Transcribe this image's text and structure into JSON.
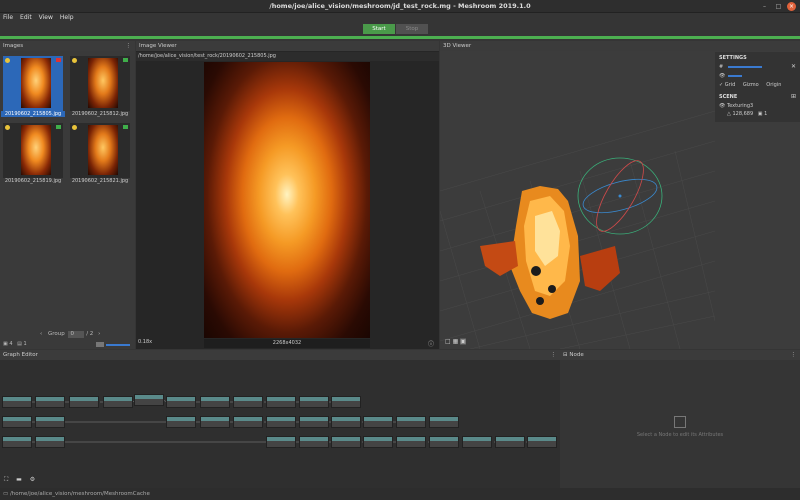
{
  "window": {
    "title": "/home/joe/alice_vision/meshroom/jd_test_rock.mg - Meshroom 2019.1.0"
  },
  "menu": [
    "File",
    "Edit",
    "View",
    "Help"
  ],
  "actions": {
    "start": "Start",
    "stop": "Stop"
  },
  "images_panel": {
    "title": "Images",
    "thumbnails": [
      {
        "label": "20190602_215805.jpg",
        "selected": true
      },
      {
        "label": "20190602_215812.jpg",
        "selected": false
      },
      {
        "label": "20190602_215819.jpg",
        "selected": false
      },
      {
        "label": "20190602_215821.jpg",
        "selected": false
      }
    ],
    "footer_count": "4",
    "footer_sel": "1",
    "group_label": "Group",
    "group_value": "0",
    "group_total": "/ 2"
  },
  "image_viewer": {
    "title": "Image Viewer",
    "path": "/home/joe/alice_vision/test_rock/20190602_215805.jpg",
    "zoom": "0.18x",
    "resolution": "2268x4032"
  },
  "viewer3d": {
    "title": "3D Viewer",
    "settings": {
      "title": "SETTINGS",
      "grid": "Grid",
      "gizmo": "Gizmo",
      "origin": "Origin"
    },
    "scene": {
      "title": "SCENE",
      "item": "Texturing3",
      "tri_count": "128,689",
      "cam_count": "1"
    }
  },
  "graph_editor": {
    "title": "Graph Editor"
  },
  "node_panel": {
    "title": "Node",
    "hint": "Select a Node to edit its Attributes"
  },
  "status": {
    "path": "/home/joe/alice_vision/meshroom/MeshroomCache"
  },
  "colors": {
    "accent": "#4caf50",
    "selection": "#2c68b8",
    "node_header": "#5a8a8a"
  }
}
